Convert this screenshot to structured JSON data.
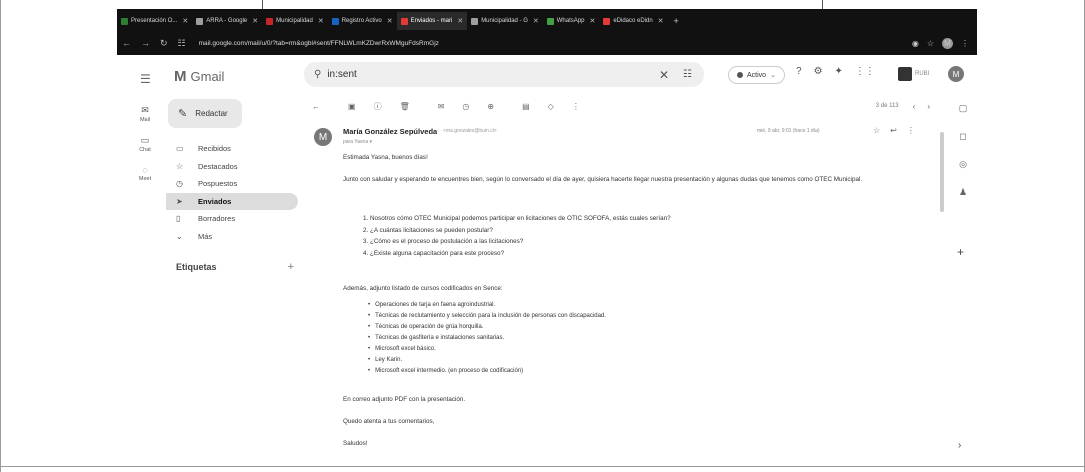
{
  "browser": {
    "tabs": [
      {
        "label": "Presentación O...",
        "color": "#2e7d32"
      },
      {
        "label": "ARRA - Google",
        "color": "#9e9e9e"
      },
      {
        "label": "Municipalidad",
        "color": "#c62828"
      },
      {
        "label": "Registro Activo",
        "color": "#1565c0"
      },
      {
        "label": "Enviados - mari",
        "color": "#e53935"
      },
      {
        "label": "Municipalidad - G",
        "color": "#9e9e9e"
      },
      {
        "label": "WhatsApp",
        "color": "#43a047"
      },
      {
        "label": "eDidaco eDidn",
        "color": "#e53935"
      }
    ],
    "url": "mail.google.com/mail/u/0/?tab=rm&ogbl#sent/FFNLWLmKZDwrRxWMguFdsRmGjz"
  },
  "gmail": {
    "app_name": "Gmail",
    "search_value": "in:sent",
    "status_label": "Activo",
    "org_label": "RUBI",
    "avatar_letter": "M"
  },
  "rail": [
    {
      "label": "Mail",
      "icon": "mail-icon"
    },
    {
      "label": "Chat",
      "icon": "chat-icon"
    },
    {
      "label": "Meet",
      "icon": "meet-icon"
    }
  ],
  "sidebar": {
    "compose_label": "Redactar",
    "items": [
      {
        "label": "Recibidos",
        "icon": "inbox-icon"
      },
      {
        "label": "Destacados",
        "icon": "star-icon"
      },
      {
        "label": "Pospuestos",
        "icon": "clock-icon"
      },
      {
        "label": "Enviados",
        "icon": "send-icon",
        "active": true
      },
      {
        "label": "Borradores",
        "icon": "draft-icon"
      },
      {
        "label": "Más",
        "icon": "chevron-down-icon"
      }
    ],
    "labels_title": "Etiquetas"
  },
  "toolbar": {
    "count": "3 de 113"
  },
  "message": {
    "sender_name": "María González Sepúlveda",
    "sender_email": "<ma.gonzalez@buin.cl>",
    "to": "para Yasna",
    "date": "mié, 9 abr, 9:01 (hace 1 día)",
    "avatar_letter": "M",
    "greeting": "Estimada Yasna, buenos días!",
    "intro": "Junto con saludar y esperando te encuentres bien, según lo conversado el día de ayer, quisiera hacerte llegar nuestra presentación y algunas dudas que tenemos como OTEC Municipal.",
    "questions": [
      "1. Nosotros cómo OTEC Municipal podemos participar en licitaciones de OTIC SOFOFA, estás cuales serían?",
      "2. ¿A cuántas licitaciones se pueden postular?",
      "3. ¿Cómo es el proceso de postulación a las licitaciones?",
      "4. ¿Existe alguna capacitación para este proceso?"
    ],
    "courses_intro": "Además, adjunto listado de cursos codificados en Sence:",
    "courses": [
      "Operaciones de tarja en faena agroindustrial.",
      "Técnicas de reclutamiento y selección para la inclusión de personas con discapacidad.",
      "Técnicas de operación de grúa horquilla.",
      "Técnicas de gasfitería e instalaciones sanitarias.",
      "Microsoft excel básico.",
      "Ley Karin.",
      "Microsoft excel intermedio. (en proceso de codificación)"
    ],
    "attachment_note": "En correo adjunto PDF con la presentación.",
    "closing": "Quedo atenta a tus comentarios,",
    "sign_off": "Saludos!"
  }
}
